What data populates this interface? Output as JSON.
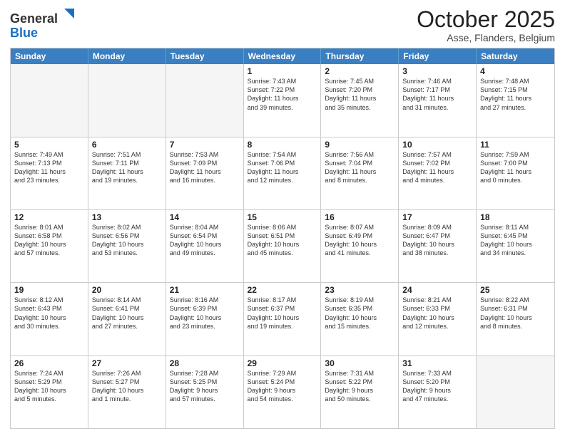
{
  "header": {
    "logo_line1": "General",
    "logo_line2": "Blue",
    "month": "October 2025",
    "location": "Asse, Flanders, Belgium"
  },
  "weekdays": [
    "Sunday",
    "Monday",
    "Tuesday",
    "Wednesday",
    "Thursday",
    "Friday",
    "Saturday"
  ],
  "rows": [
    [
      {
        "day": "",
        "info": "",
        "empty": true
      },
      {
        "day": "",
        "info": "",
        "empty": true
      },
      {
        "day": "",
        "info": "",
        "empty": true
      },
      {
        "day": "1",
        "info": "Sunrise: 7:43 AM\nSunset: 7:22 PM\nDaylight: 11 hours\nand 39 minutes.",
        "empty": false
      },
      {
        "day": "2",
        "info": "Sunrise: 7:45 AM\nSunset: 7:20 PM\nDaylight: 11 hours\nand 35 minutes.",
        "empty": false
      },
      {
        "day": "3",
        "info": "Sunrise: 7:46 AM\nSunset: 7:17 PM\nDaylight: 11 hours\nand 31 minutes.",
        "empty": false
      },
      {
        "day": "4",
        "info": "Sunrise: 7:48 AM\nSunset: 7:15 PM\nDaylight: 11 hours\nand 27 minutes.",
        "empty": false
      }
    ],
    [
      {
        "day": "5",
        "info": "Sunrise: 7:49 AM\nSunset: 7:13 PM\nDaylight: 11 hours\nand 23 minutes.",
        "empty": false
      },
      {
        "day": "6",
        "info": "Sunrise: 7:51 AM\nSunset: 7:11 PM\nDaylight: 11 hours\nand 19 minutes.",
        "empty": false
      },
      {
        "day": "7",
        "info": "Sunrise: 7:53 AM\nSunset: 7:09 PM\nDaylight: 11 hours\nand 16 minutes.",
        "empty": false
      },
      {
        "day": "8",
        "info": "Sunrise: 7:54 AM\nSunset: 7:06 PM\nDaylight: 11 hours\nand 12 minutes.",
        "empty": false
      },
      {
        "day": "9",
        "info": "Sunrise: 7:56 AM\nSunset: 7:04 PM\nDaylight: 11 hours\nand 8 minutes.",
        "empty": false
      },
      {
        "day": "10",
        "info": "Sunrise: 7:57 AM\nSunset: 7:02 PM\nDaylight: 11 hours\nand 4 minutes.",
        "empty": false
      },
      {
        "day": "11",
        "info": "Sunrise: 7:59 AM\nSunset: 7:00 PM\nDaylight: 11 hours\nand 0 minutes.",
        "empty": false
      }
    ],
    [
      {
        "day": "12",
        "info": "Sunrise: 8:01 AM\nSunset: 6:58 PM\nDaylight: 10 hours\nand 57 minutes.",
        "empty": false
      },
      {
        "day": "13",
        "info": "Sunrise: 8:02 AM\nSunset: 6:56 PM\nDaylight: 10 hours\nand 53 minutes.",
        "empty": false
      },
      {
        "day": "14",
        "info": "Sunrise: 8:04 AM\nSunset: 6:54 PM\nDaylight: 10 hours\nand 49 minutes.",
        "empty": false
      },
      {
        "day": "15",
        "info": "Sunrise: 8:06 AM\nSunset: 6:51 PM\nDaylight: 10 hours\nand 45 minutes.",
        "empty": false
      },
      {
        "day": "16",
        "info": "Sunrise: 8:07 AM\nSunset: 6:49 PM\nDaylight: 10 hours\nand 41 minutes.",
        "empty": false
      },
      {
        "day": "17",
        "info": "Sunrise: 8:09 AM\nSunset: 6:47 PM\nDaylight: 10 hours\nand 38 minutes.",
        "empty": false
      },
      {
        "day": "18",
        "info": "Sunrise: 8:11 AM\nSunset: 6:45 PM\nDaylight: 10 hours\nand 34 minutes.",
        "empty": false
      }
    ],
    [
      {
        "day": "19",
        "info": "Sunrise: 8:12 AM\nSunset: 6:43 PM\nDaylight: 10 hours\nand 30 minutes.",
        "empty": false
      },
      {
        "day": "20",
        "info": "Sunrise: 8:14 AM\nSunset: 6:41 PM\nDaylight: 10 hours\nand 27 minutes.",
        "empty": false
      },
      {
        "day": "21",
        "info": "Sunrise: 8:16 AM\nSunset: 6:39 PM\nDaylight: 10 hours\nand 23 minutes.",
        "empty": false
      },
      {
        "day": "22",
        "info": "Sunrise: 8:17 AM\nSunset: 6:37 PM\nDaylight: 10 hours\nand 19 minutes.",
        "empty": false
      },
      {
        "day": "23",
        "info": "Sunrise: 8:19 AM\nSunset: 6:35 PM\nDaylight: 10 hours\nand 15 minutes.",
        "empty": false
      },
      {
        "day": "24",
        "info": "Sunrise: 8:21 AM\nSunset: 6:33 PM\nDaylight: 10 hours\nand 12 minutes.",
        "empty": false
      },
      {
        "day": "25",
        "info": "Sunrise: 8:22 AM\nSunset: 6:31 PM\nDaylight: 10 hours\nand 8 minutes.",
        "empty": false
      }
    ],
    [
      {
        "day": "26",
        "info": "Sunrise: 7:24 AM\nSunset: 5:29 PM\nDaylight: 10 hours\nand 5 minutes.",
        "empty": false
      },
      {
        "day": "27",
        "info": "Sunrise: 7:26 AM\nSunset: 5:27 PM\nDaylight: 10 hours\nand 1 minute.",
        "empty": false
      },
      {
        "day": "28",
        "info": "Sunrise: 7:28 AM\nSunset: 5:25 PM\nDaylight: 9 hours\nand 57 minutes.",
        "empty": false
      },
      {
        "day": "29",
        "info": "Sunrise: 7:29 AM\nSunset: 5:24 PM\nDaylight: 9 hours\nand 54 minutes.",
        "empty": false
      },
      {
        "day": "30",
        "info": "Sunrise: 7:31 AM\nSunset: 5:22 PM\nDaylight: 9 hours\nand 50 minutes.",
        "empty": false
      },
      {
        "day": "31",
        "info": "Sunrise: 7:33 AM\nSunset: 5:20 PM\nDaylight: 9 hours\nand 47 minutes.",
        "empty": false
      },
      {
        "day": "",
        "info": "",
        "empty": true
      }
    ]
  ]
}
